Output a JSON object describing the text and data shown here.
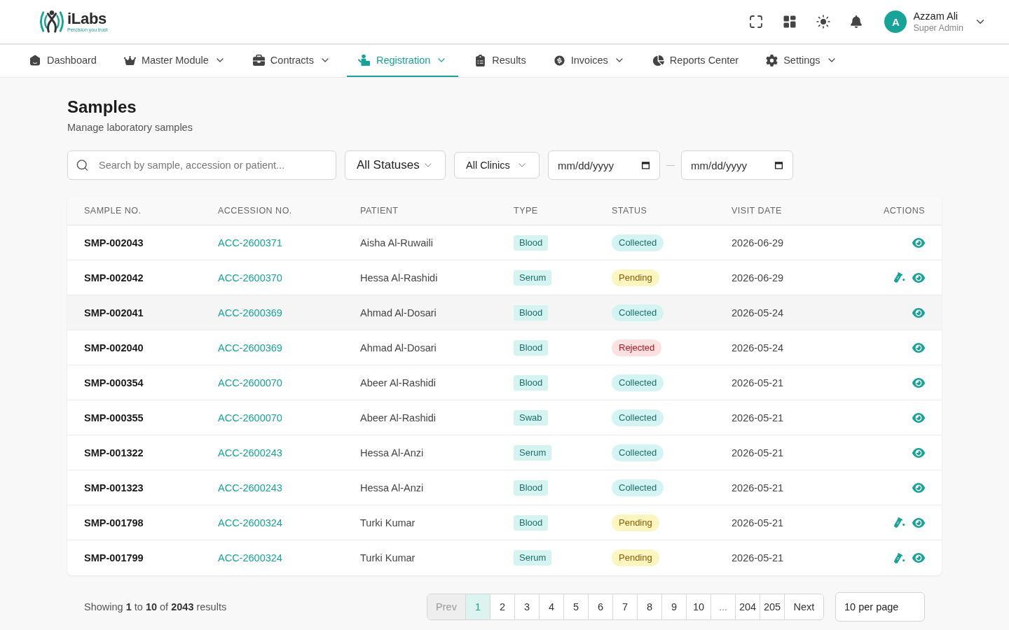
{
  "header": {
    "logo": {
      "name": "iLabs",
      "tagline": "Percision you trust"
    },
    "user": {
      "initial": "A",
      "name": "Azzam Ali",
      "role": "Super Admin"
    }
  },
  "nav": [
    {
      "label": "Dashboard",
      "selected": false,
      "has_menu": false
    },
    {
      "label": "Master Module",
      "selected": false,
      "has_menu": true
    },
    {
      "label": "Contracts",
      "selected": false,
      "has_menu": true
    },
    {
      "label": "Registration",
      "selected": true,
      "has_menu": true
    },
    {
      "label": "Results",
      "selected": false,
      "has_menu": false
    },
    {
      "label": "Invoices",
      "selected": false,
      "has_menu": true
    },
    {
      "label": "Reports Center",
      "selected": false,
      "has_menu": false
    },
    {
      "label": "Settings",
      "selected": false,
      "has_menu": true
    }
  ],
  "page": {
    "title": "Samples",
    "subtitle": "Manage laboratory samples"
  },
  "filters": {
    "search": {
      "placeholder": "Search by sample, accession or patient..."
    },
    "status": {
      "value": "All Statuses"
    },
    "clinic": {
      "value": "All Clinics"
    },
    "date_from": {
      "placeholder": "mm/dd/yyyy"
    },
    "range_separator": "—",
    "date_to": {
      "placeholder": "mm/dd/yyyy"
    }
  },
  "table": {
    "columns": [
      "SAMPLE NO.",
      "ACCESSION NO.",
      "PATIENT",
      "TYPE",
      "STATUS",
      "VISIT DATE",
      "ACTIONS"
    ],
    "rows": [
      {
        "sample": "SMP-002043",
        "accession": "ACC-2600371",
        "patient": "Aisha Al-Ruwaili",
        "type": "Blood",
        "status": {
          "text": "Collected",
          "kind": "collected"
        },
        "visit_date": "2026-06-29",
        "can_collect": false,
        "hovered": false
      },
      {
        "sample": "SMP-002042",
        "accession": "ACC-2600370",
        "patient": "Hessa Al-Rashidi",
        "type": "Serum",
        "status": {
          "text": "Pending",
          "kind": "pending"
        },
        "visit_date": "2026-06-29",
        "can_collect": true,
        "hovered": false
      },
      {
        "sample": "SMP-002041",
        "accession": "ACC-2600369",
        "patient": "Ahmad Al-Dosari",
        "type": "Blood",
        "status": {
          "text": "Collected",
          "kind": "collected"
        },
        "visit_date": "2026-05-24",
        "can_collect": false,
        "hovered": true
      },
      {
        "sample": "SMP-002040",
        "accession": "ACC-2600369",
        "patient": "Ahmad Al-Dosari",
        "type": "Blood",
        "status": {
          "text": "Rejected",
          "kind": "rejected"
        },
        "visit_date": "2026-05-24",
        "can_collect": false,
        "hovered": false
      },
      {
        "sample": "SMP-000354",
        "accession": "ACC-2600070",
        "patient": "Abeer Al-Rashidi",
        "type": "Blood",
        "status": {
          "text": "Collected",
          "kind": "collected"
        },
        "visit_date": "2026-05-21",
        "can_collect": false,
        "hovered": false
      },
      {
        "sample": "SMP-000355",
        "accession": "ACC-2600070",
        "patient": "Abeer Al-Rashidi",
        "type": "Swab",
        "status": {
          "text": "Collected",
          "kind": "collected"
        },
        "visit_date": "2026-05-21",
        "can_collect": false,
        "hovered": false
      },
      {
        "sample": "SMP-001322",
        "accession": "ACC-2600243",
        "patient": "Hessa Al-Anzi",
        "type": "Serum",
        "status": {
          "text": "Collected",
          "kind": "collected"
        },
        "visit_date": "2026-05-21",
        "can_collect": false,
        "hovered": false
      },
      {
        "sample": "SMP-001323",
        "accession": "ACC-2600243",
        "patient": "Hessa Al-Anzi",
        "type": "Blood",
        "status": {
          "text": "Collected",
          "kind": "collected"
        },
        "visit_date": "2026-05-21",
        "can_collect": false,
        "hovered": false
      },
      {
        "sample": "SMP-001798",
        "accession": "ACC-2600324",
        "patient": "Turki Kumar",
        "type": "Blood",
        "status": {
          "text": "Pending",
          "kind": "pending"
        },
        "visit_date": "2026-05-21",
        "can_collect": true,
        "hovered": false
      },
      {
        "sample": "SMP-001799",
        "accession": "ACC-2600324",
        "patient": "Turki Kumar",
        "type": "Serum",
        "status": {
          "text": "Pending",
          "kind": "pending"
        },
        "visit_date": "2026-05-21",
        "can_collect": true,
        "hovered": false
      }
    ]
  },
  "pagination": {
    "summary": "Showing **1** to **10** of **2043** results",
    "prev": {
      "label": "Prev",
      "disabled": true
    },
    "pages": [
      {
        "label": "1",
        "kind": "page",
        "selected": true
      },
      {
        "label": "2",
        "kind": "page",
        "selected": false
      },
      {
        "label": "3",
        "kind": "page",
        "selected": false
      },
      {
        "label": "4",
        "kind": "page",
        "selected": false
      },
      {
        "label": "5",
        "kind": "page",
        "selected": false
      },
      {
        "label": "6",
        "kind": "page",
        "selected": false
      },
      {
        "label": "7",
        "kind": "page",
        "selected": false
      },
      {
        "label": "8",
        "kind": "page",
        "selected": false
      },
      {
        "label": "9",
        "kind": "page",
        "selected": false
      },
      {
        "label": "10",
        "kind": "page",
        "selected": false
      },
      {
        "label": "...",
        "kind": "ellipsis",
        "selected": false
      },
      {
        "label": "204",
        "kind": "page",
        "selected": false
      },
      {
        "label": "205",
        "kind": "page",
        "selected": false
      }
    ],
    "next": {
      "label": "Next",
      "disabled": false
    },
    "per_page": "10 per page"
  }
}
